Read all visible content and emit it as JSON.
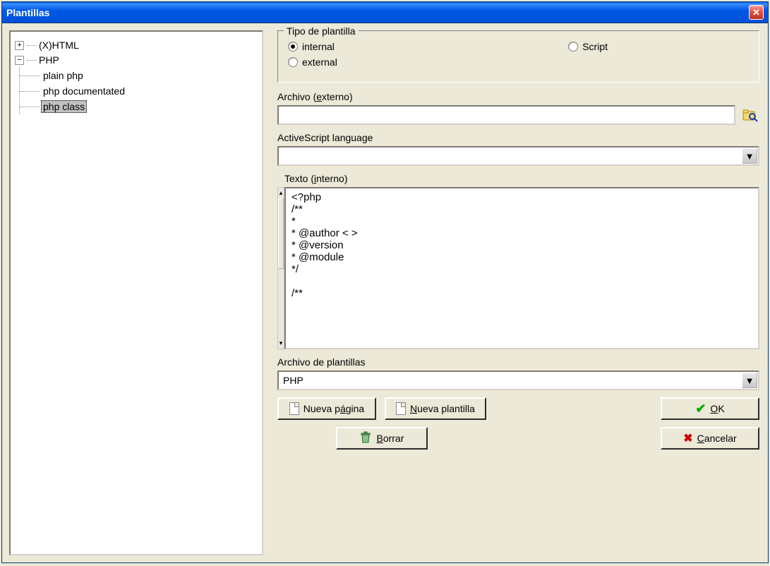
{
  "window": {
    "title": "Plantillas"
  },
  "tree": {
    "root1": {
      "label": "(X)HTML",
      "expanded": false
    },
    "root2": {
      "label": "PHP",
      "expanded": true,
      "children": [
        {
          "label": "plain php",
          "selected": false
        },
        {
          "label": "php documentated",
          "selected": false
        },
        {
          "label": "php class",
          "selected": true
        }
      ]
    }
  },
  "groupbox": {
    "legend": "Tipo de plantilla",
    "options": {
      "internal": {
        "label": "internal",
        "checked": true
      },
      "script": {
        "label": "Script",
        "checked": false
      },
      "external": {
        "label": "external",
        "checked": false
      }
    }
  },
  "archivo_externo": {
    "label": "Archivo (externo)",
    "value": ""
  },
  "activescript": {
    "label": "ActiveScript language",
    "value": ""
  },
  "texto_interno": {
    "label": "Texto (interno)",
    "value": "<?php\n/**\n*\n* @author < >\n* @version\n* @module\n*/\n\n/**"
  },
  "archivo_plantillas": {
    "label": "Archivo de plantillas",
    "value": "PHP"
  },
  "buttons": {
    "nueva_pagina": "Nueva página",
    "nueva_plantilla": "Nueva plantilla",
    "borrar": "Borrar",
    "ok": "OK",
    "cancelar": "Cancelar"
  }
}
